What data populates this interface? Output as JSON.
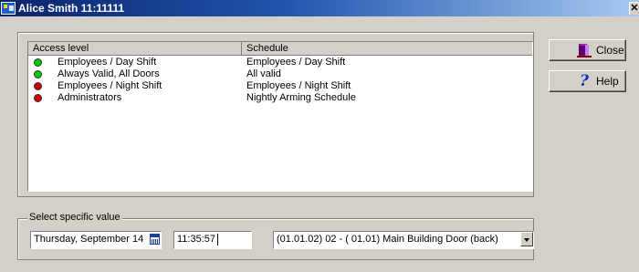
{
  "window": {
    "title": "Alice Smith  11:11111",
    "close_glyph": "✕"
  },
  "list": {
    "columns": [
      "Access level",
      "Schedule"
    ],
    "rows": [
      {
        "status": "green",
        "access": "Employees / Day Shift",
        "schedule": "Employees / Day Shift"
      },
      {
        "status": "green",
        "access": "Always Valid, All Doors",
        "schedule": "All valid"
      },
      {
        "status": "red",
        "access": "Employees / Night Shift",
        "schedule": "Employees / Night Shift"
      },
      {
        "status": "red",
        "access": "Administrators",
        "schedule": "Nightly Arming Schedule"
      }
    ]
  },
  "specific": {
    "legend": "Select specific value",
    "date_value": "Thursday, September 14",
    "time_value": "11:35:57",
    "door_value": "(01.01.02) 02 - ( 01.01) Main Building Door (back)"
  },
  "buttons": {
    "close_label": "Close",
    "help_label": "Help",
    "help_glyph": "?"
  },
  "colors": {
    "status_green": "#00cc00",
    "status_red": "#d00000",
    "title_gradient_start": "#0a246a"
  }
}
